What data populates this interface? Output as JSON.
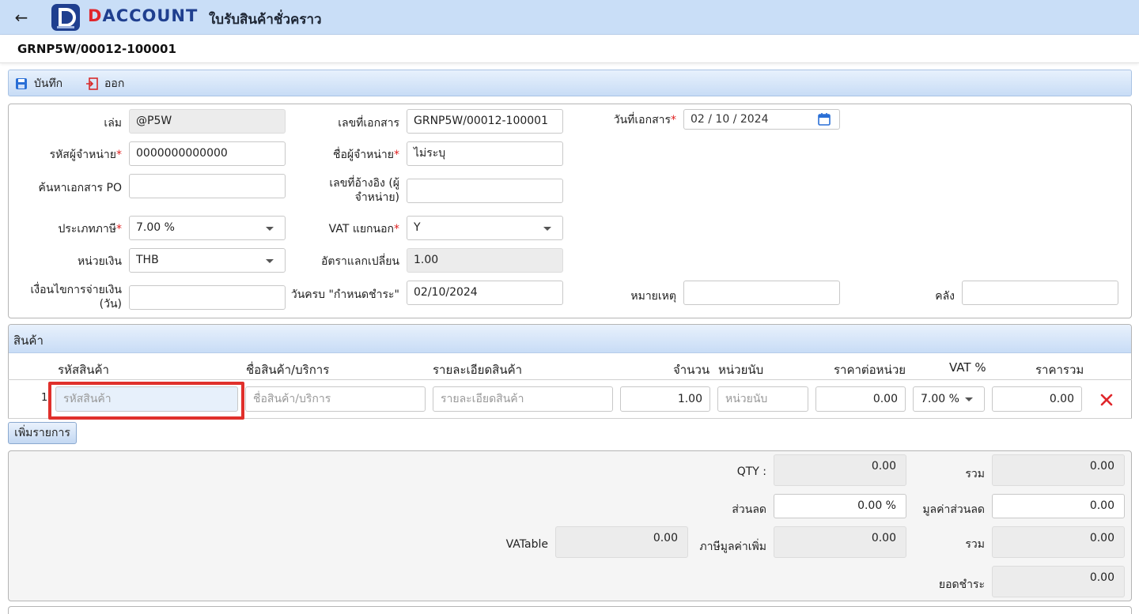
{
  "header": {
    "logo_d": "D",
    "logo_rest": "ACCOUNT",
    "title": "ใบรับสินค้าชั่วคราว",
    "doc_number": "GRNP5W/00012-100001"
  },
  "toolbar": {
    "save_label": "บันทึก",
    "exit_label": "ออก"
  },
  "form": {
    "book_label": "เล่ม",
    "book_value": "@P5W",
    "docno_label": "เลขที่เอกสาร",
    "docno_value": "GRNP5W/00012-100001",
    "docdate_label": "วันที่เอกสาร",
    "docdate_value": "02 / 10 /  2024",
    "vendor_code_label": "รหัสผู้จำหน่าย",
    "vendor_code_value": "0000000000000",
    "vendor_name_label": "ชื่อผู้จำหน่าย",
    "vendor_name_value": "ไม่ระบุ",
    "po_label": "ค้นหาเอกสาร PO",
    "po_value": "",
    "ref_label_1": "เลขที่อ้างอิง (ผู้",
    "ref_label_2": "จำหน่าย)",
    "ref_value": "",
    "taxtype_label": "ประเภทภาษี",
    "taxtype_value": "7.00 %",
    "vat_label": "VAT แยกนอก",
    "vat_value": "Y",
    "currency_label": "หน่วยเงิน",
    "currency_value": "THB",
    "rate_label": "อัตราแลกเปลี่ยน",
    "rate_value": "1.00",
    "terms_label_1": "เงื่อนไขการจ่ายเงิน",
    "terms_label_2": "(วัน)",
    "terms_value": "",
    "due_label": "วันครบ \"กำหนดชำระ\"",
    "due_value": "02/10/2024",
    "remark_label": "หมายเหตุ",
    "remark_value": "",
    "warehouse_label": "คลัง",
    "warehouse_value": ""
  },
  "items": {
    "section_title": "สินค้า",
    "columns": {
      "code": "รหัสสินค้า",
      "name": "ชื่อสินค้า/บริการ",
      "detail": "รายละเอียดสินค้า",
      "qty": "จำนวน",
      "unit": "หน่วยนับ",
      "price": "ราคาต่อหน่วย",
      "vat": "VAT %",
      "total": "ราคารวม"
    },
    "row": {
      "num": "1.",
      "code_placeholder": "รหัสสินค้า",
      "name_placeholder": "ชื่อสินค้า/บริการ",
      "detail_placeholder": "รายละเอียดสินค้า",
      "qty": "1.00",
      "unit_placeholder": "หน่วยนับ",
      "price": "0.00",
      "vat": "7.00 %",
      "total": "0.00"
    },
    "add_label": "เพิ่มรายการ"
  },
  "summary": {
    "qty_label": "QTY :",
    "qty_value": "0.00",
    "sum_label": "รวม",
    "sum_value": "0.00",
    "discount_label": "ส่วนลด",
    "discount_value": "0.00 %",
    "discount_amount_label": "มูลค่าส่วนลด",
    "discount_amount_value": "0.00",
    "vatable_label": "VATable",
    "vatable_value": "0.00",
    "vat_label": "ภาษีมูลค่าเพิ่ม",
    "vat_value": "0.00",
    "total_label": "รวม",
    "total_value": "0.00",
    "payable_label": "ยอดชำระ",
    "payable_value": "0.00"
  },
  "colors": {
    "accent": "#1f3f8f",
    "brand_red": "#e0262b",
    "highlight": "#e0302b"
  }
}
